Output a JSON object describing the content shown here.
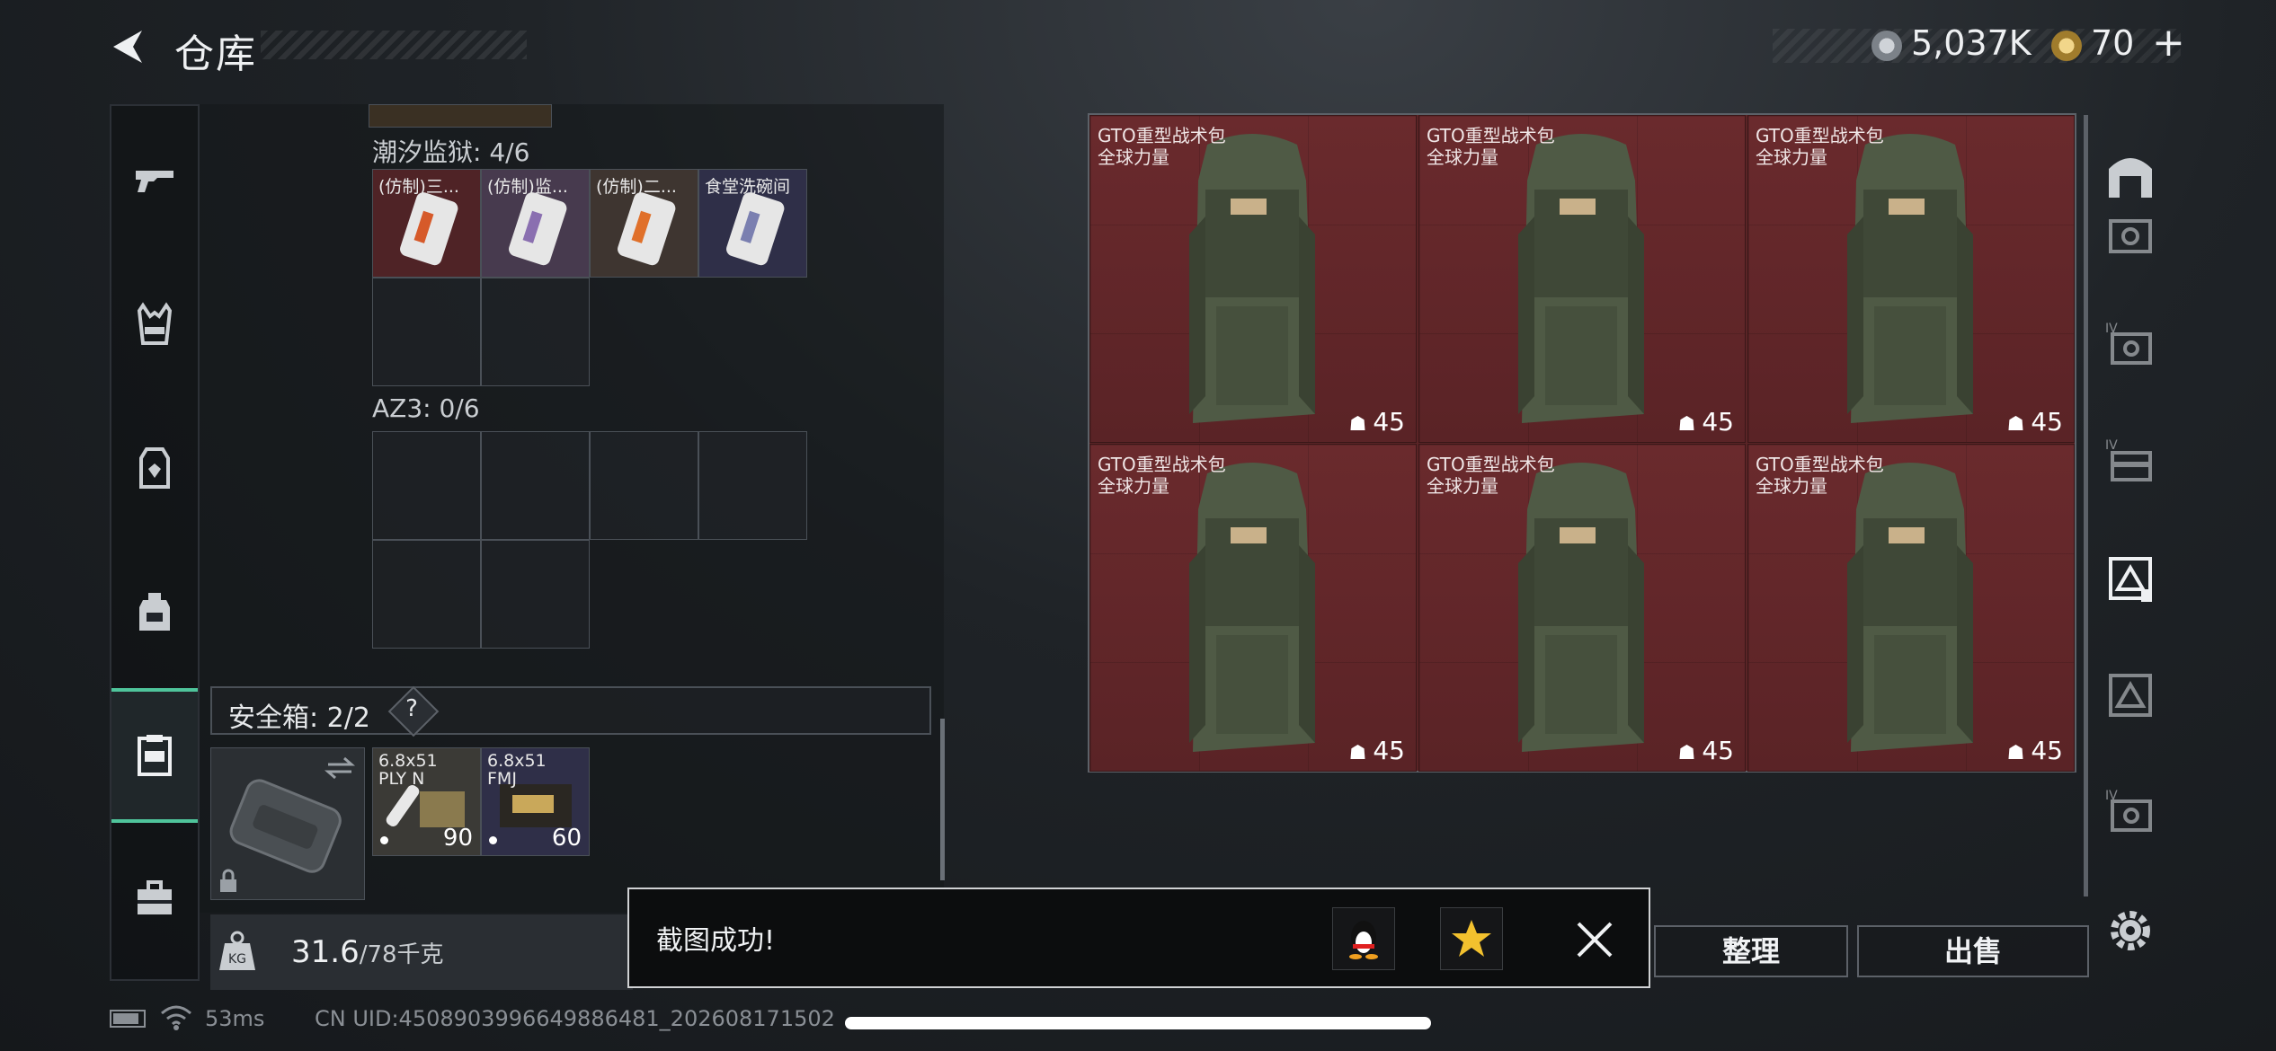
{
  "header": {
    "title": "仓库",
    "currency1": "5,037K",
    "currency2": "70",
    "currency2_plus": "+"
  },
  "left_sidebar": {
    "items": [
      {
        "icon": "gun-icon"
      },
      {
        "icon": "vest-icon"
      },
      {
        "icon": "armor-icon"
      },
      {
        "icon": "backpack-icon"
      },
      {
        "icon": "safe-box-icon",
        "active": true
      },
      {
        "icon": "briefcase-icon"
      }
    ]
  },
  "left_panel": {
    "section1_label": "潮汐监狱: 4/6",
    "section1_items": [
      {
        "name": "(仿制)三..."
      },
      {
        "name": "(仿制)监..."
      },
      {
        "name": "(仿制)二..."
      },
      {
        "name": "食堂洗碗间"
      }
    ],
    "section2_label": "AZ3: 0/6",
    "safe_header": "安全箱: 2/2",
    "safe_help": "?",
    "safe_items": [
      {
        "name": "6.8x51\nPLY N",
        "count": "90"
      },
      {
        "name": "6.8x51\nFMJ",
        "count": "60"
      }
    ]
  },
  "weight": {
    "current": "31.6",
    "max": "/78千克"
  },
  "right_grid": {
    "items": [
      {
        "name": "GTO重型战术包",
        "owner": "全球力量",
        "weight": "45"
      },
      {
        "name": "GTO重型战术包",
        "owner": "全球力量",
        "weight": "45"
      },
      {
        "name": "GTO重型战术包",
        "owner": "全球力量",
        "weight": "45"
      },
      {
        "name": "GTO重型战术包",
        "owner": "全球力量",
        "weight": "45"
      },
      {
        "name": "GTO重型战术包",
        "owner": "全球力量",
        "weight": "45"
      },
      {
        "name": "GTO重型战术包",
        "owner": "全球力量",
        "weight": "45"
      }
    ]
  },
  "buttons": {
    "sort": "整理",
    "sell": "出售"
  },
  "toast": {
    "message": "截图成功!"
  },
  "status": {
    "ping": "53ms",
    "uid": "CN UID:4508903996649886481_202608171502"
  },
  "colors": {
    "accent": "#4fc49b",
    "grid_bg": "#5a2426"
  }
}
